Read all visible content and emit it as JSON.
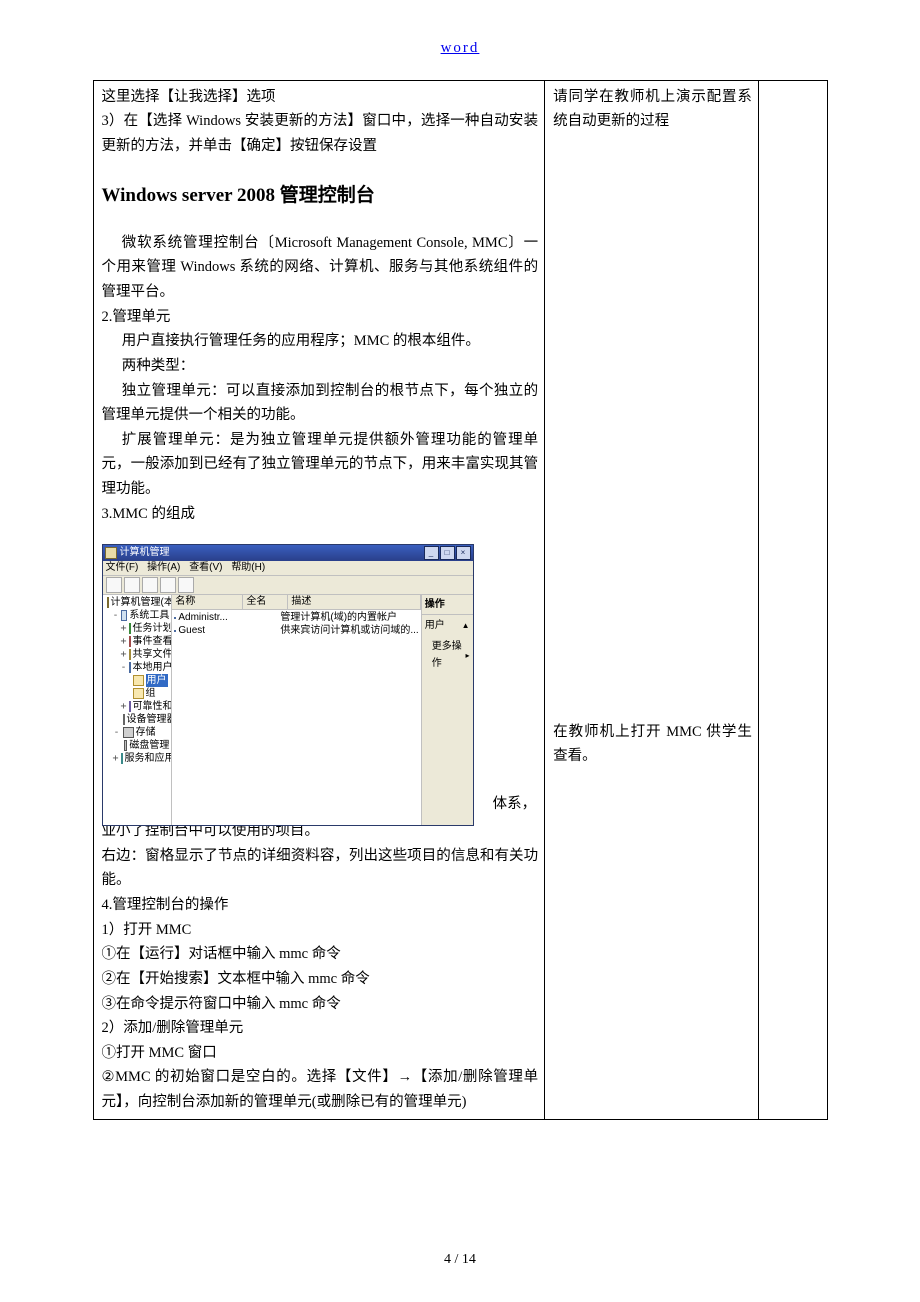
{
  "header": {
    "word_link": "word"
  },
  "left": {
    "l1": "这里选择【让我选择】选项",
    "l2": "3）在【选择 Windows 安装更新的方法】窗口中，选择一种自动安装更新的方法，并单击【确定】按钮保存设置",
    "heading": "Windows server 2008  管理控制台",
    "p1": "微软系统管理控制台〔Microsoft Management Console, MMC〕一个用来管理 Windows  系统的网络、计算机、服务与其他系统组件的管理平台。",
    "p2": "2.管理单元",
    "p3": "用户直接执行管理任务的应用程序；MMC  的根本组件。",
    "p4": "两种类型：",
    "p5": "独立管理单元：可以直接添加到控制台的根节点下，每个独立的管理单元提供一个相关的功能。",
    "p6": "扩展管理单元：是为独立管理单元提供额外管理功能的管理单元，一般添加到已经有了独立管理单元的节点下，用来丰富实现其管理功能。",
    "p7": "3.MMC 的组成",
    "overlap1": "体系，",
    "overlap2": "业小了捏制台中可以使用的坝目。",
    "p8": "右边：窗格显示了节点的详细资料容，列出这些项目的信息和有关功能。",
    "p9": "4.管理控制台的操作",
    "p10": "1）打开 MMC",
    "p11": "①在【运行】对话框中输入 mmc 命令",
    "p12": "②在【开始搜索】文本框中输入 mmc 命令",
    "p13": "③在命令提示符窗口中输入 mmc 命令",
    "p14": "2）添加/删除管理单元",
    "p15": "①打开 MMC  窗口",
    "p16": "②MMC  的初始窗口是空白的。选择【文件】→【添加/删除管理单元】，向控制台添加新的管理单元(或删除已有的管理单元)"
  },
  "right": {
    "r1": "请同学在教师机上演示配置系统自动更新的过程",
    "r2": "在教师机上打开 MMC 供学生查看。"
  },
  "footer": {
    "page": "4 / 14"
  },
  "mmc": {
    "title": "计算机管理",
    "menu": {
      "file": "文件(F)",
      "action": "操作(A)",
      "view": "查看(V)",
      "help": "帮助(H)"
    },
    "tree": {
      "root": "计算机管理(本地)",
      "systools": "系统工具",
      "sched": "任务计划程序",
      "event": "事件查看器",
      "share": "共享文件夹",
      "ug": "本地用户和组",
      "users": "用户",
      "groups": "组",
      "perf": "可靠性和性能",
      "dev": "设备管理器",
      "storage": "存储",
      "disk": "磁盘管理",
      "svc": "服务和应用程序"
    },
    "list": {
      "col_name": "名称",
      "col_fullname": "全名",
      "col_desc": "描述",
      "row1_name": "Administr...",
      "row1_desc": "管理计算机(域)的内置帐户",
      "row2_name": "Guest",
      "row2_desc": "供来宾访问计算机或访问域的..."
    },
    "actions": {
      "header": "操作",
      "users": "用户",
      "more": "更多操作"
    }
  }
}
